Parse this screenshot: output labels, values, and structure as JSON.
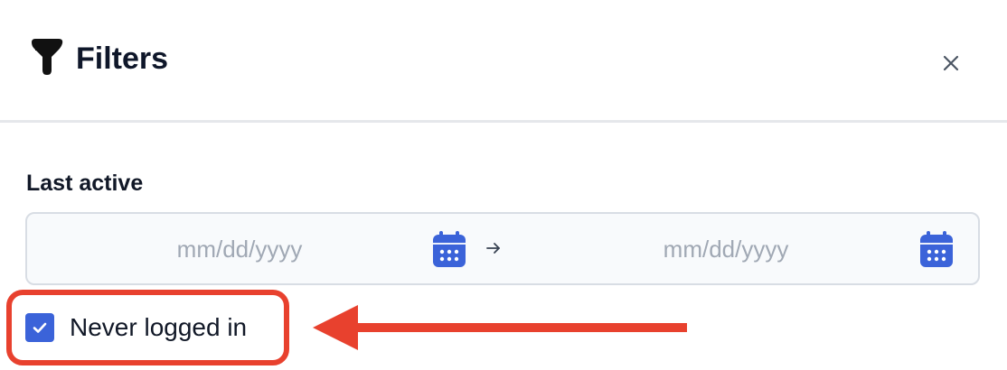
{
  "header": {
    "title": "Filters",
    "filter_icon": "filter-icon",
    "close_icon": "close-icon"
  },
  "last_active": {
    "label": "Last active",
    "start_placeholder": "mm/dd/yyyy",
    "end_placeholder": "mm/dd/yyyy",
    "start_value": "",
    "end_value": "",
    "calendar_icon": "calendar-icon",
    "separator_icon": "arrow-right-icon"
  },
  "never_logged_in": {
    "label": "Never logged in",
    "checked": true
  },
  "annotation": {
    "highlight": "highlight-box",
    "arrow": "pointer-arrow"
  },
  "colors": {
    "accent": "#3b63d9",
    "annotation": "#e8412e",
    "field_bg": "#f8fafc",
    "field_border": "#d8dde4",
    "placeholder": "#a0a8b4",
    "divider": "#e5e7eb"
  }
}
